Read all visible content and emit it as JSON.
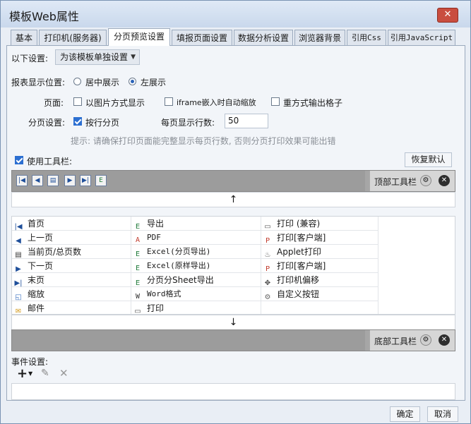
{
  "window": {
    "title": "模板Web属性",
    "close": "✕"
  },
  "tabs": [
    {
      "label": "基本"
    },
    {
      "label": "打印机(服务器)"
    },
    {
      "label": "分页预览设置"
    },
    {
      "label": "填报页面设置"
    },
    {
      "label": "数据分析设置"
    },
    {
      "label": "浏览器背景"
    },
    {
      "label": "引用Css"
    },
    {
      "label": "引用JavaScript"
    }
  ],
  "settings": {
    "scope_label": "以下设置:",
    "scope_value": "为该模板单独设置",
    "display_label": "报表显示位置:",
    "display_center": "居中展示",
    "display_left": "左展示",
    "page_label": "页面:",
    "as_image": "以图片方式显示",
    "iframe_scale": "iframe嵌入时自动缩放",
    "repeat_cells": "重方式输出格子",
    "pagination_label": "分页设置:",
    "by_row": "按行分页",
    "rows_label": "每页显示行数:",
    "rows_value": "50",
    "hint": "提示: 请确保打印页面能完整显示每页行数, 否则分页打印效果可能出错",
    "use_toolbar": "使用工具栏:",
    "restore": "恢复默认"
  },
  "top_toolbar": {
    "label": "顶部工具栏"
  },
  "bottom_toolbar": {
    "label": "底部工具栏"
  },
  "arrows": {
    "up": "↑",
    "down": "↓"
  },
  "grid": {
    "col1": [
      "首页",
      "上一页",
      "当前页/总页数",
      "下一页",
      "末页",
      "缩放",
      "邮件"
    ],
    "col2": [
      "导出",
      "PDF",
      "Excel(分页导出)",
      "Excel(原样导出)",
      "分页分Sheet导出",
      "Word格式",
      "打印"
    ],
    "col3": [
      "打印 (兼容)",
      "打印[客户端]",
      "Applet打印",
      "打印[客户端]",
      "打印机偏移",
      "自定义按钮"
    ]
  },
  "events": {
    "label": "事件设置:"
  },
  "buttons": {
    "ok": "确定",
    "cancel": "取消"
  },
  "colors": {
    "toolbar_bg": "#a6a6a6",
    "accent": "#2c6fd1",
    "close_red": "#c94d3f"
  }
}
